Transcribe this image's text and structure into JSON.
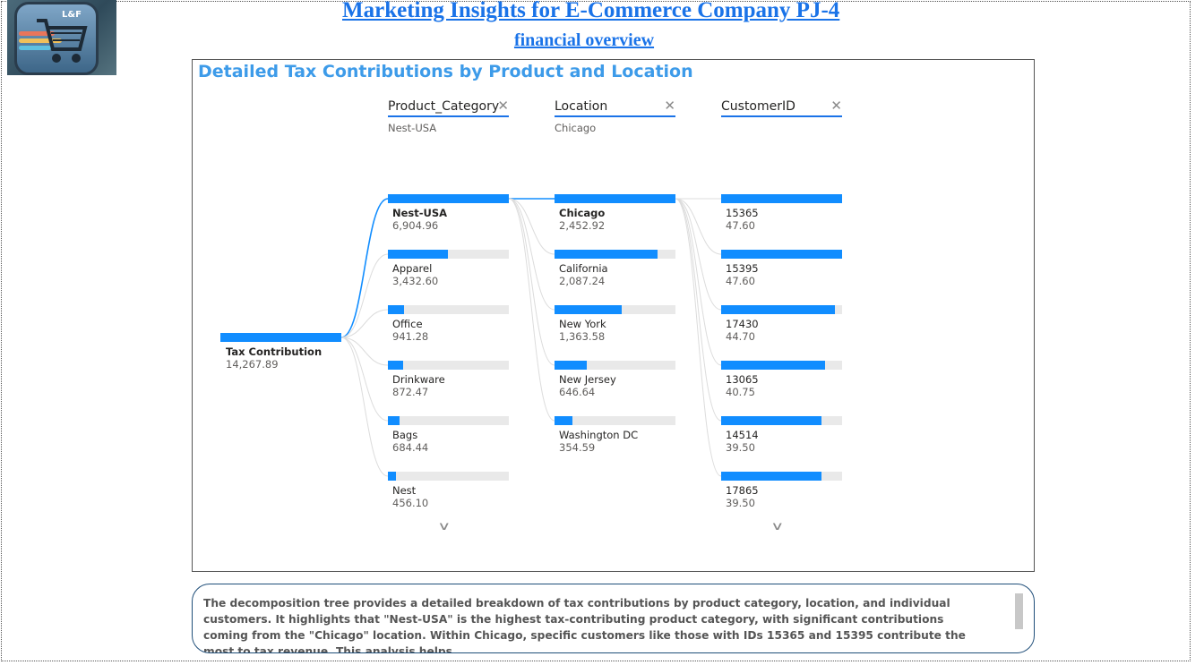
{
  "header": {
    "title": "Marketing Insights for E-Commerce Company PJ-4",
    "subtitle": "financial overview",
    "logo_text": "L&F"
  },
  "visual": {
    "title": "Detailed Tax Contributions by Product and Location"
  },
  "tree": {
    "root": {
      "label": "Tax Contribution",
      "value": "14,267.89",
      "fraction": 1.0
    },
    "levels": [
      {
        "name": "Product_Category",
        "filter": "Nest-USA",
        "nodes": [
          {
            "label": "Nest-USA",
            "value": "6,904.96",
            "fraction": 1.0,
            "selected": true
          },
          {
            "label": "Apparel",
            "value": "3,432.60",
            "fraction": 0.497
          },
          {
            "label": "Office",
            "value": "941.28",
            "fraction": 0.136
          },
          {
            "label": "Drinkware",
            "value": "872.47",
            "fraction": 0.126
          },
          {
            "label": "Bags",
            "value": "684.44",
            "fraction": 0.099
          },
          {
            "label": "Nest",
            "value": "456.10",
            "fraction": 0.066
          }
        ],
        "more": true
      },
      {
        "name": "Location",
        "filter": "Chicago",
        "nodes": [
          {
            "label": "Chicago",
            "value": "2,452.92",
            "fraction": 1.0,
            "selected": true
          },
          {
            "label": "California",
            "value": "2,087.24",
            "fraction": 0.851
          },
          {
            "label": "New York",
            "value": "1,363.58",
            "fraction": 0.556
          },
          {
            "label": "New Jersey",
            "value": "646.64",
            "fraction": 0.264
          },
          {
            "label": "Washington DC",
            "value": "354.59",
            "fraction": 0.145
          }
        ],
        "more": false
      },
      {
        "name": "CustomerID",
        "filter": "",
        "nodes": [
          {
            "label": "15365",
            "value": "47.60",
            "fraction": 1.0,
            "selected": false
          },
          {
            "label": "15395",
            "value": "47.60",
            "fraction": 1.0
          },
          {
            "label": "17430",
            "value": "44.70",
            "fraction": 0.939
          },
          {
            "label": "13065",
            "value": "40.75",
            "fraction": 0.856
          },
          {
            "label": "14514",
            "value": "39.50",
            "fraction": 0.83
          },
          {
            "label": "17865",
            "value": "39.50",
            "fraction": 0.83
          }
        ],
        "more": true
      }
    ],
    "icons": {
      "remove": "close-icon",
      "more": "chevron-down-icon"
    },
    "colors": {
      "bar": "#118dff",
      "track": "#e9e9e9",
      "link_active": "#118dff",
      "link": "#dcdcdc"
    }
  },
  "note": {
    "text": "The decomposition tree provides a detailed breakdown of tax contributions by product category, location, and individual customers. It highlights that \"Nest-USA\" is the highest tax-contributing product category, with significant contributions coming from the \"Chicago\" location. Within Chicago, specific customers like those with IDs 15365 and 15395 contribute the most to tax revenue. This analysis helps"
  },
  "colors": {
    "title": "#1a73e8",
    "visual_title": "#3d9be9"
  }
}
